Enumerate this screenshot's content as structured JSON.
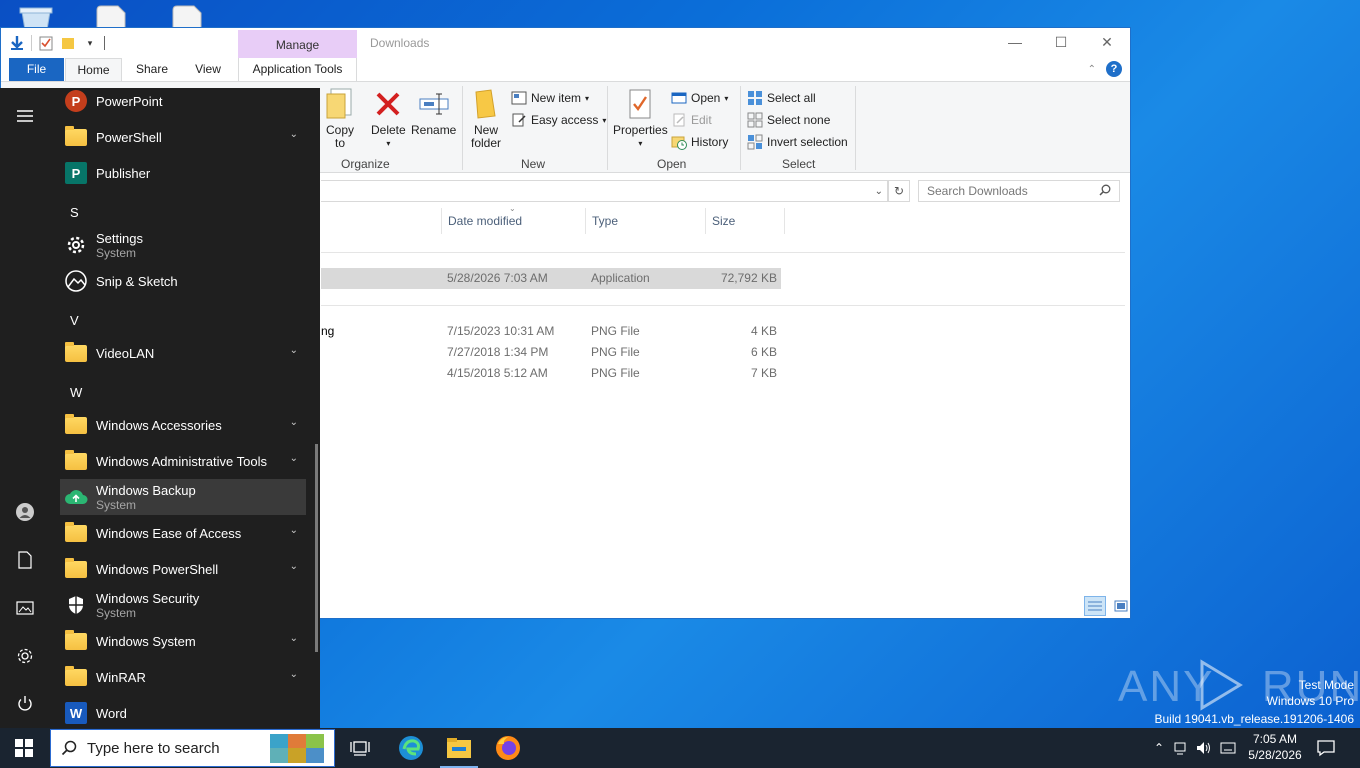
{
  "explorer": {
    "title": "Downloads",
    "manage_tab": "Manage",
    "tabs": {
      "file": "File",
      "home": "Home",
      "share": "Share",
      "view": "View",
      "app_tools": "Application Tools"
    },
    "ribbon": {
      "copy_to": "Copy\nto",
      "delete": "Delete",
      "rename": "Rename",
      "new_folder": "New\nfolder",
      "new_item": "New item",
      "easy_access": "Easy access",
      "properties": "Properties",
      "open": "Open",
      "edit": "Edit",
      "history": "History",
      "select_all": "Select all",
      "select_none": "Select none",
      "invert_selection": "Invert selection",
      "groups": {
        "organize": "Organize",
        "new": "New",
        "open": "Open",
        "select": "Select"
      }
    },
    "search_placeholder": "Search Downloads",
    "columns": {
      "date": "Date modified",
      "type": "Type",
      "size": "Size"
    },
    "files": [
      {
        "name": "",
        "date": "5/28/2026 7:03 AM",
        "type": "Application",
        "size": "72,792 KB"
      },
      {
        "name": "ng",
        "date": "7/15/2023 10:31 AM",
        "type": "PNG File",
        "size": "4 KB"
      },
      {
        "name": "",
        "date": "7/27/2018 1:34 PM",
        "type": "PNG File",
        "size": "6 KB"
      },
      {
        "name": "",
        "date": "4/15/2018 5:12 AM",
        "type": "PNG File",
        "size": "7 KB"
      }
    ]
  },
  "start_menu": {
    "apps": {
      "powerpoint": "PowerPoint",
      "powershell": "PowerShell",
      "publisher": "Publisher",
      "letter_s": "S",
      "settings": "Settings",
      "settings_sub": "System",
      "snip": "Snip & Sketch",
      "letter_v": "V",
      "videolan": "VideoLAN",
      "letter_w": "W",
      "win_accessories": "Windows Accessories",
      "win_admin": "Windows Administrative Tools",
      "win_backup": "Windows Backup",
      "win_backup_sub": "System",
      "win_ease": "Windows Ease of Access",
      "win_ps": "Windows PowerShell",
      "win_security": "Windows Security",
      "win_security_sub": "System",
      "win_system": "Windows System",
      "winrar": "WinRAR",
      "word": "Word"
    }
  },
  "taskbar": {
    "search_placeholder": "Type here to search",
    "time": "7:05 AM",
    "date": "5/28/2026"
  },
  "watermark": {
    "logo": "ANY RUN",
    "mode": "Test Mode",
    "os": "Windows 10 Pro",
    "build": "Build 19041.vb_release.191206-1406"
  },
  "colors": {
    "accent": "#1a66c2",
    "manage_tab": "#e8cdf7",
    "start_bg": "#1f1f1f",
    "taskbar_bg": "#1a2430",
    "desktop": "#0b6fd9"
  }
}
